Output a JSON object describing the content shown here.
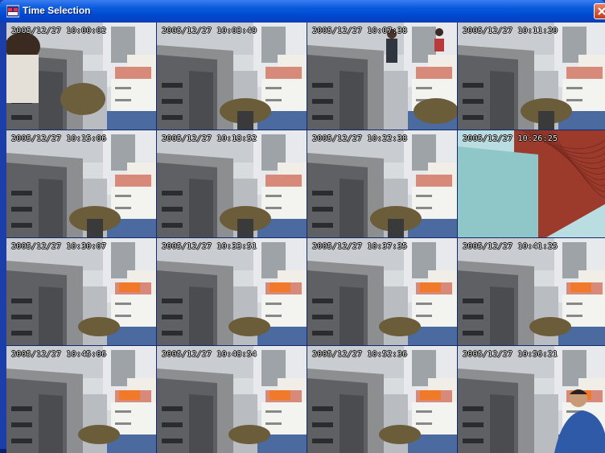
{
  "window": {
    "title": "Time Selection"
  },
  "colors": {
    "titlebar": "#0047d0",
    "selection": "#e8111b"
  },
  "thumbnails": [
    {
      "timestamp": "2005/12/27 10:00:02",
      "scene": "person-left"
    },
    {
      "timestamp": "2005/12/27 10:03:49",
      "scene": "chair"
    },
    {
      "timestamp": "2005/12/27 10:07:38",
      "scene": "people-background",
      "selected": true
    },
    {
      "timestamp": "2005/12/27 10:11:20",
      "scene": "chair"
    },
    {
      "timestamp": "2005/12/27 10:15:06",
      "scene": "chair"
    },
    {
      "timestamp": "2005/12/27 10:18:52",
      "scene": "chair"
    },
    {
      "timestamp": "2005/12/27 10:22:38",
      "scene": "chair"
    },
    {
      "timestamp": "2005/12/27 10:26:25",
      "scene": "occluded"
    },
    {
      "timestamp": "2005/12/27 10:30:07",
      "scene": "empty"
    },
    {
      "timestamp": "2005/12/27 10:33:51",
      "scene": "empty"
    },
    {
      "timestamp": "2005/12/27 10:37:35",
      "scene": "empty"
    },
    {
      "timestamp": "2005/12/27 10:41:25",
      "scene": "empty"
    },
    {
      "timestamp": "2005/12/27 10:45:06",
      "scene": "empty"
    },
    {
      "timestamp": "2005/12/27 10:48:54",
      "scene": "empty"
    },
    {
      "timestamp": "2005/12/27 10:52:36",
      "scene": "empty"
    },
    {
      "timestamp": "2005/12/27 10:56:21",
      "scene": "person-right"
    }
  ]
}
